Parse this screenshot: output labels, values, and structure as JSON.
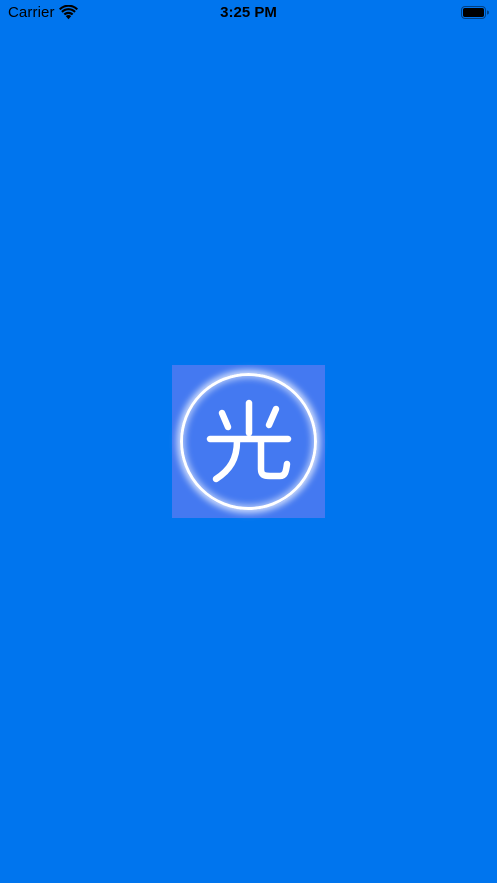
{
  "status_bar": {
    "carrier": "Carrier",
    "time": "3:25 PM",
    "wifi_icon": "wifi-icon",
    "battery_icon": "battery-icon"
  },
  "splash": {
    "logo_icon": "light-character-logo-icon",
    "logo_character": "光",
    "colors": {
      "background": "#0075EE",
      "logo_tile": "#4479F1",
      "glyph": "#FFFFFF"
    }
  }
}
